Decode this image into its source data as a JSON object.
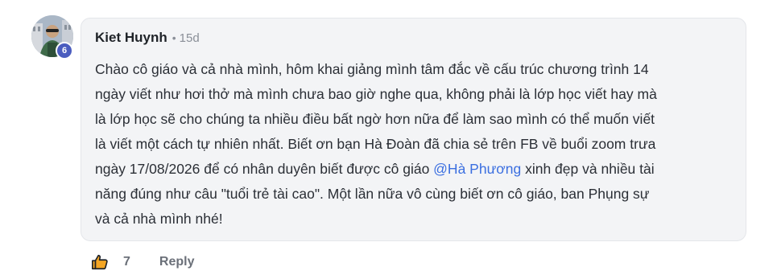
{
  "comment": {
    "author": "Kiet Huynh",
    "separator": "•",
    "time_ago": "15d",
    "level_badge": "6",
    "text_before_mention": "Chào cô giáo và cả nhà mình, hôm khai giảng mình tâm đắc về cấu trúc chương trình 14\nngày viết như hơi thở mà mình chưa bao giờ nghe qua, không phải là lớp học viết hay mà\nlà lớp học sẽ cho chúng ta nhiều điều bất ngờ hơn nữa để làm sao mình có thể muốn viết\nlà viết một cách tự nhiên nhất. Biết ơn bạn Hà Đoàn đã chia sẻ trên FB về buổi zoom trưa\nngày 17/08/2026 để có nhân duyên biết được cô giáo ",
    "mention": "@Hà Phương",
    "text_after_mention": " xinh đẹp và nhiều tài\nnăng đúng như câu \"tuổi trẻ tài cao\". Một lần nữa vô cùng biết ơn cô giáo, ban Phụng sự\nvà cả nhà mình nhé!"
  },
  "actions": {
    "like_icon": "thumbs-up-icon",
    "like_count": "7",
    "reply_label": "Reply"
  },
  "colors": {
    "mention": "#3b6fe0",
    "badge": "#4b5dbf",
    "bubble_bg": "#f3f4f6"
  }
}
